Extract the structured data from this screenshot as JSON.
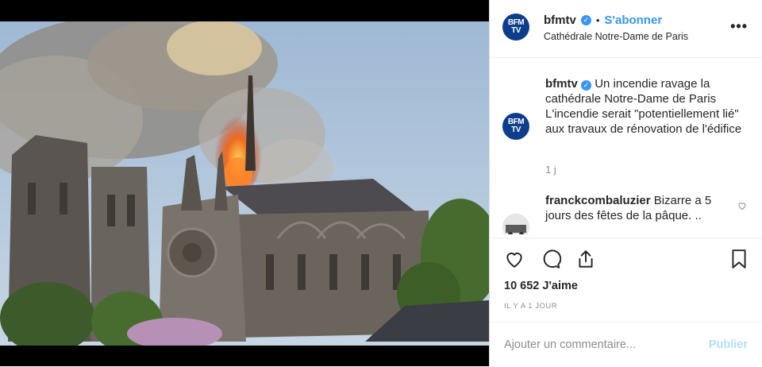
{
  "post": {
    "username": "bfmtv",
    "subscribe_label": "S'abonner",
    "location": "Cathédrale Notre-Dame de Paris",
    "more_label": "•••",
    "avatar_text": "BFM TV"
  },
  "caption": {
    "username": "bfmtv",
    "text": "Un incendie ravage la cathédrale Notre-Dame de Paris L'incendie serait \"potentiellement lié\" aux travaux de rénovation de l'édifice",
    "time": "1 j"
  },
  "comment": {
    "username": "franckcombaluzier",
    "text": "Bizarre a 5 jours des fêtes de la pâque. .."
  },
  "stats": {
    "likes": "10 652 J'aime",
    "posted_ago": "IL Y A 1 JOUR"
  },
  "add_comment": {
    "placeholder": "Ajouter un commentaire...",
    "publish_label": "Publier"
  },
  "colors": {
    "brand_blue": "#0d3e8c",
    "link_blue": "#3897f0",
    "muted": "#8e8e8e",
    "publish_disabled": "#b2dffc"
  },
  "icons": [
    "verified-badge-icon",
    "more-options-icon",
    "heart-icon",
    "comment-icon",
    "share-icon",
    "bookmark-icon",
    "small-heart-icon"
  ]
}
